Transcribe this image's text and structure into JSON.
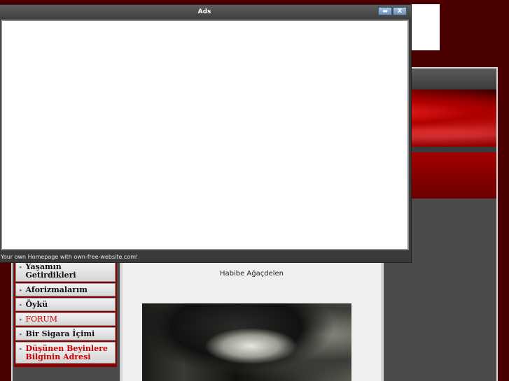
{
  "popup": {
    "title": "Ads",
    "footer": "Your own Homepage with own-free-website.com!",
    "minimize_glyph": "▬",
    "close_glyph": "X"
  },
  "nav": {
    "items": [
      {
        "label": "Yaşamın Getirdikleri",
        "style": "bold"
      },
      {
        "label": "Aforizmalarım",
        "style": "bold"
      },
      {
        "label": "Öykü",
        "style": "bold"
      },
      {
        "label": "FORUM",
        "style": "red"
      },
      {
        "label": "Bir Sigara İçimi",
        "style": "bold"
      },
      {
        "label": "Düşünen Beyinlere Bilginin Adresi",
        "style": "red-bold"
      }
    ],
    "bullet": "▸"
  },
  "content": {
    "author": "Habibe Ağaçdelen"
  },
  "colors": {
    "site_background": "#4a0000",
    "nav_accent": "#cc0000",
    "popup_titlebar": "#4a4a4a"
  }
}
